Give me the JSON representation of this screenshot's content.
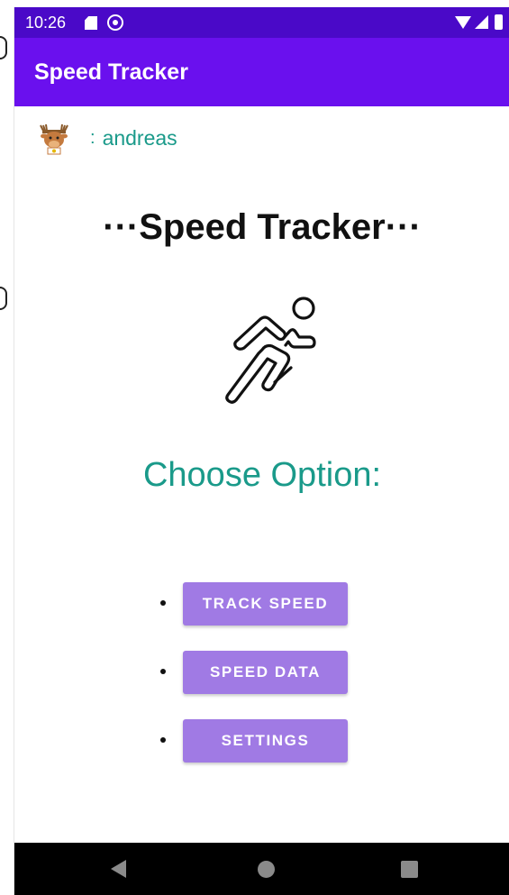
{
  "status_bar": {
    "time": "10:26",
    "icons": [
      "sd-card-icon",
      "sync-icon",
      "wifi-icon",
      "signal-icon",
      "battery-icon"
    ]
  },
  "app_bar": {
    "title": "Speed Tracker",
    "color": "#6a10ee"
  },
  "user": {
    "separator": ":",
    "name": "andreas",
    "avatar_icon": "moose-avatar-icon"
  },
  "main": {
    "title": "···Speed Tracker···",
    "hero_icon": "runner-icon",
    "prompt": "Choose Option:",
    "prompt_color": "#1a9a8a",
    "options": [
      {
        "label": "TRACK SPEED"
      },
      {
        "label": "SPEED DATA"
      },
      {
        "label": "SETTINGS"
      }
    ],
    "button_color": "#a07ae4"
  },
  "nav_bar": {
    "icons": [
      "back-icon",
      "home-icon",
      "recents-icon"
    ]
  }
}
